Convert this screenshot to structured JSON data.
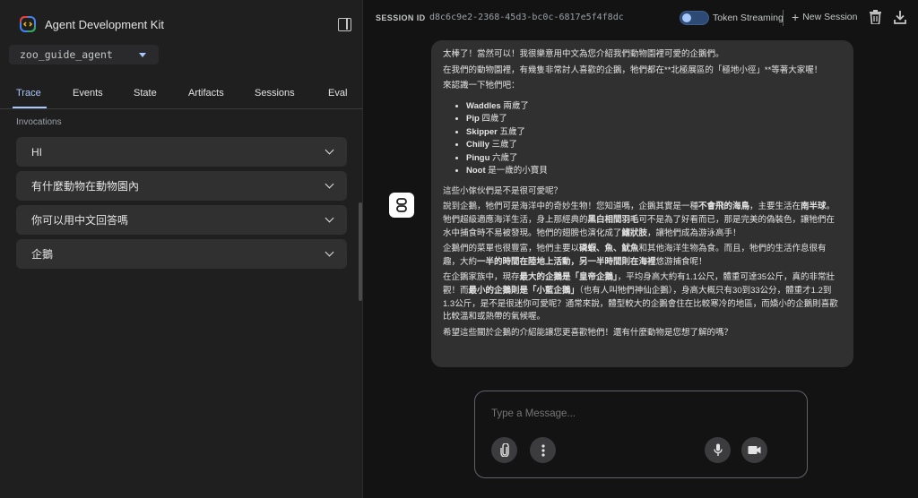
{
  "app": {
    "title": "Agent Development Kit"
  },
  "agent_select": {
    "value": "zoo_guide_agent"
  },
  "tabs": [
    {
      "label": "Trace"
    },
    {
      "label": "Events"
    },
    {
      "label": "State"
    },
    {
      "label": "Artifacts"
    },
    {
      "label": "Sessions"
    },
    {
      "label": "Eval"
    }
  ],
  "invocations": {
    "heading": "Invocations",
    "items": [
      {
        "label": "HI"
      },
      {
        "label": "有什麼動物在動物園內"
      },
      {
        "label": "你可以用中文回答嗎"
      },
      {
        "label": "企鵝"
      }
    ]
  },
  "session": {
    "label": "SESSION ID",
    "id": "d8c6c9e2-2368-45d3-bc0c-6817e5f4f8dc",
    "streaming_label": "Token Streaming",
    "new_session_label": "New Session"
  },
  "message": {
    "p1": "太棒了！當然可以！我很樂意用中文為您介紹我們動物園裡可愛的企鵝們。",
    "p2": "在我們的動物園裡，有幾隻非常討人喜歡的企鵝，牠們都在**北極展區的「極地小徑」**等著大家喔！",
    "p3": "來認識一下牠們吧：",
    "penguins": [
      {
        "name": "Waddles",
        "age": " 兩歲了"
      },
      {
        "name": "Pip",
        "age": " 四歲了"
      },
      {
        "name": "Skipper",
        "age": " 五歲了"
      },
      {
        "name": "Chilly",
        "age": " 三歲了"
      },
      {
        "name": "Pingu",
        "age": " 六歲了"
      },
      {
        "name": "Noot",
        "age": " 是一歲的小寶貝"
      }
    ],
    "p4": "這些小傢伙們是不是很可愛呢？",
    "p5a": "說到企鵝，牠們可是海洋中的奇妙生物！您知道嗎，企鵝其實是一種",
    "p5b": "不會飛的海鳥",
    "p5c": "，主要生活在",
    "p5d": "南半球",
    "p5e": "。牠們超級適應海洋生活，身上那經典的",
    "p5f": "黑白相間羽毛",
    "p5g": "可不是為了好看而已，那是完美的偽裝色，讓牠們在水中捕食時不易被發現。牠們的翅膀也演化成了",
    "p5h": "鰭狀肢",
    "p5i": "，讓牠們成為游泳高手！",
    "p6a": "企鵝們的菜單也很豐富，牠們主要以",
    "p6b": "磷蝦、魚、魷魚",
    "p6c": "和其他海洋生物為食。而且，牠們的生活作息很有趣，大約",
    "p6d": "一半的時間在陸地上活動，另一半時間則在海裡",
    "p6e": "悠游捕食呢！",
    "p7a": "在企鵝家族中，現存",
    "p7b": "最大的企鵝是「皇帝企鵝」",
    "p7c": "，平均身高大約有1.1公尺，體重可達35公斤，真的非常壯觀！而",
    "p7d": "最小的企鵝則是「小藍企鵝」",
    "p7e": "（也有人叫牠們神仙企鵝），身高大概只有30到33公分，體重才1.2到1.3公斤，是不是很迷你可愛呢？通常來說，體型較大的企鵝會住在比較寒冷的地區，而嬌小的企鵝則喜歡比較溫和或熱帶的氣候喔。",
    "p8": "希望這些關於企鵝的介紹能讓您更喜歡牠們！還有什麼動物是您想了解的嗎？"
  },
  "composer": {
    "placeholder": "Type a Message..."
  },
  "colors": {
    "accent": "#a8c7fa",
    "background": "#131314",
    "sidebar": "#1f1f1f",
    "bubble": "#303031"
  }
}
